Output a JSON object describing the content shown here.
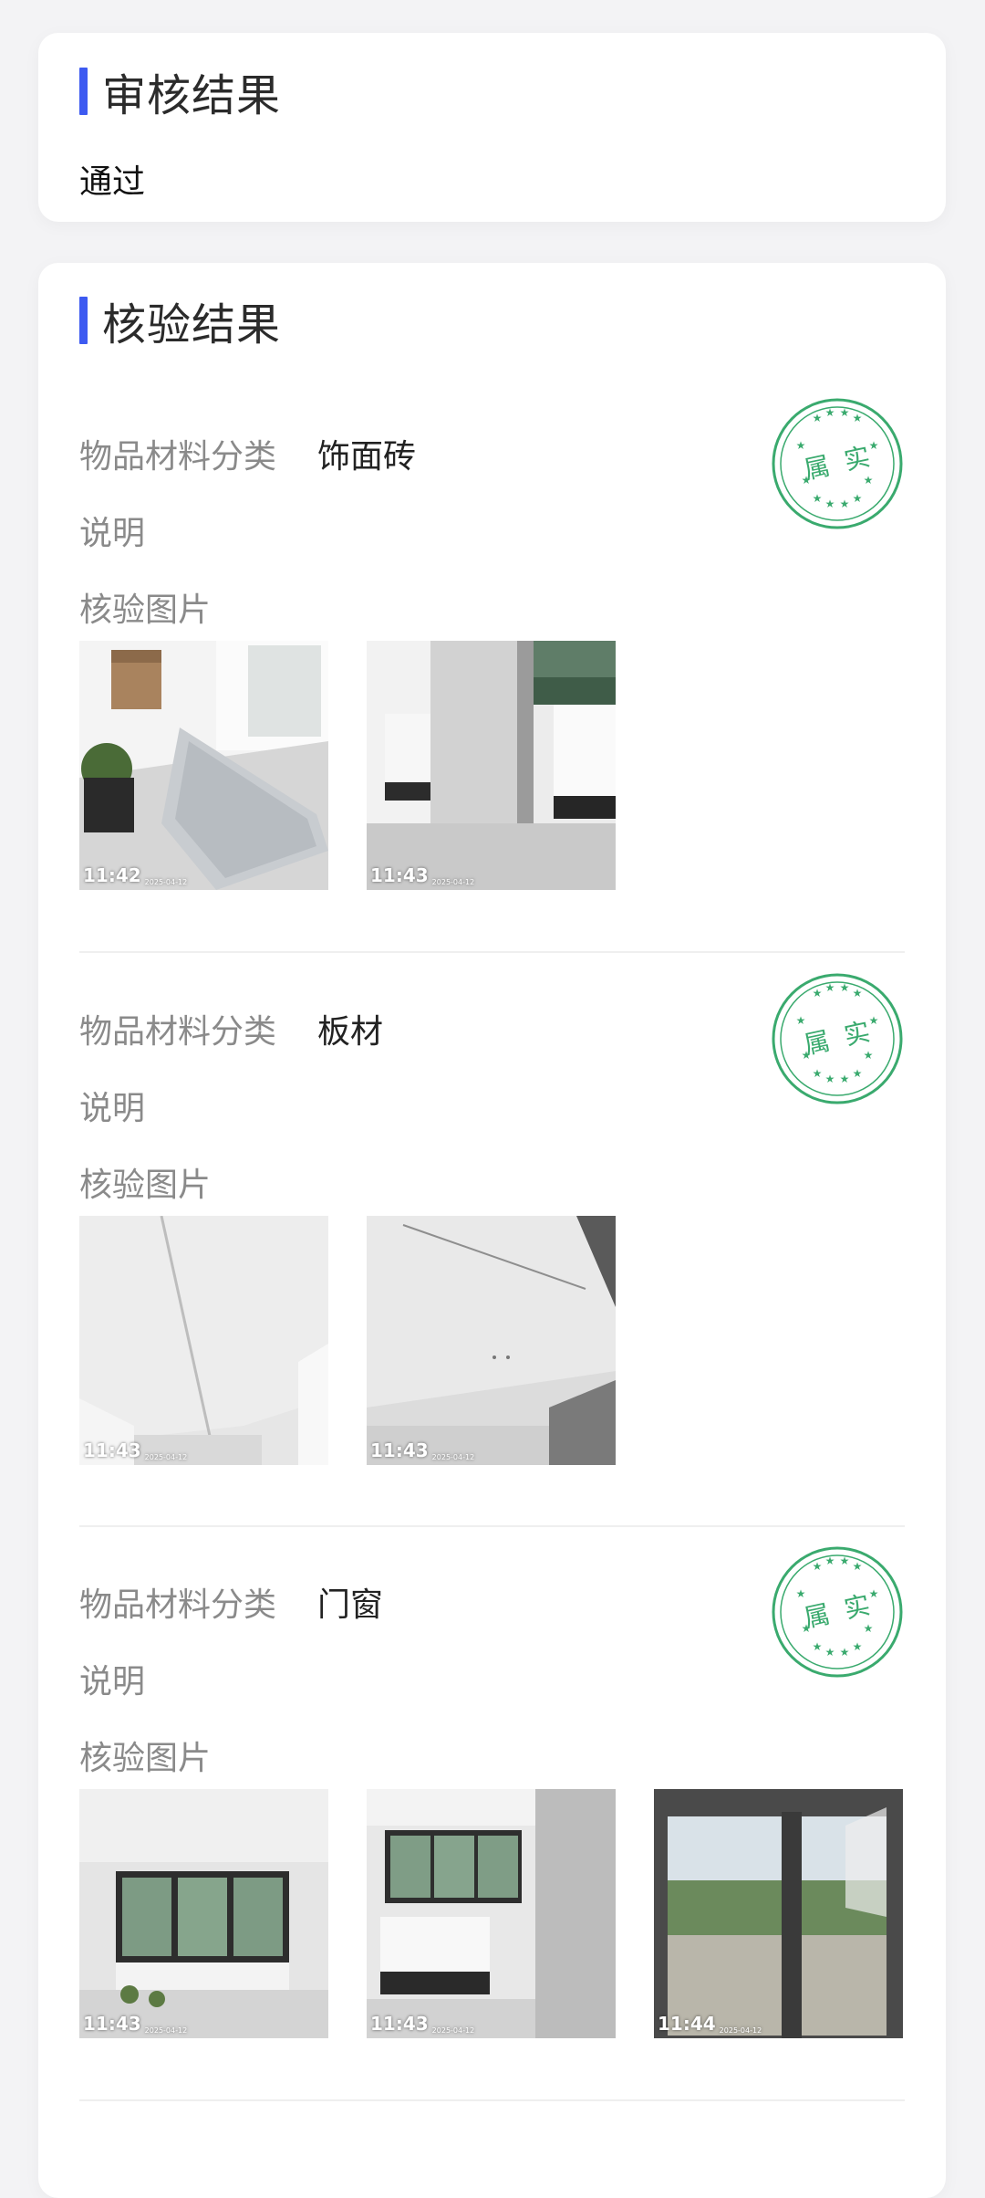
{
  "review": {
    "title": "审核结果",
    "value": "通过"
  },
  "verify": {
    "title": "核验结果",
    "category_label": "物品材料分类",
    "desc_label": "说明",
    "pics_label": "核验图片",
    "stamp_text": "属实",
    "items": [
      {
        "category": "饰面砖",
        "photos": [
          {
            "time": "11:42",
            "date": "2025-04-12"
          },
          {
            "time": "11:43",
            "date": "2025-04-12"
          }
        ]
      },
      {
        "category": "板材",
        "photos": [
          {
            "time": "11:43",
            "date": "2025-04-12"
          },
          {
            "time": "11:43",
            "date": "2025-04-12"
          }
        ]
      },
      {
        "category": "门窗",
        "photos": [
          {
            "time": "11:43",
            "date": "2025-04-12"
          },
          {
            "time": "11:43",
            "date": "2025-04-12"
          },
          {
            "time": "11:44",
            "date": "2025-04-12"
          }
        ]
      }
    ]
  },
  "colors": {
    "accent": "#3d5af1",
    "stamp": "#3aaa6e"
  }
}
